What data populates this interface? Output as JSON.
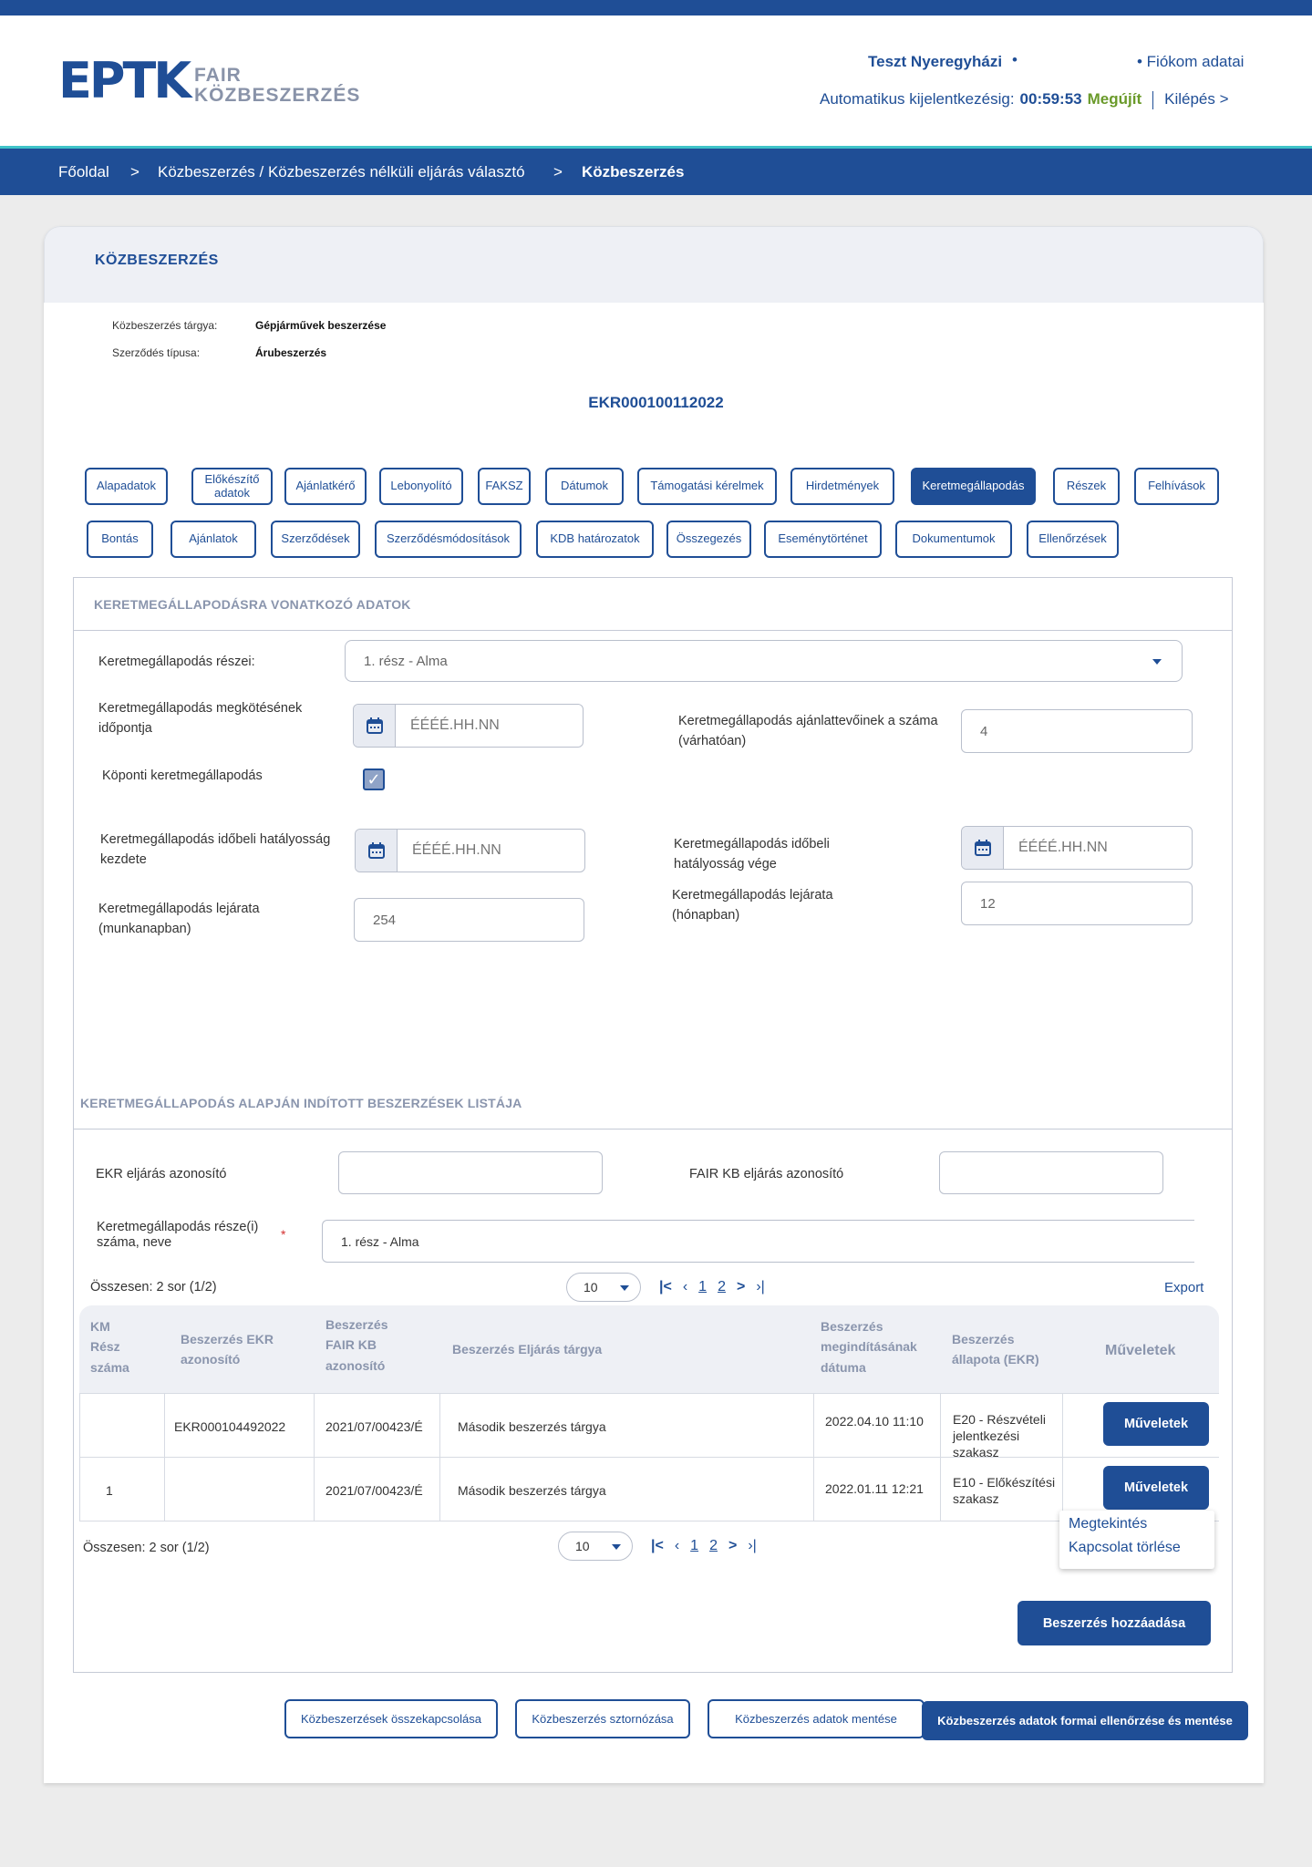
{
  "header": {
    "logo_mark": "EPTK",
    "logo_line1": "FAIR",
    "logo_line2": "KÖZBESZERZÉS",
    "user_name": "Teszt Nyeregyházi",
    "user_dot": "•",
    "account_link": "• Fiókom adatai",
    "auto_logout_label": "Automatikus kijelentkezésig:",
    "auto_logout_time": "00:59:53",
    "renew_label": "Megújít",
    "logout_label": "Kilépés >"
  },
  "breadcrumb": {
    "home": "Főoldal",
    "sep1": ">",
    "selector": "Közbeszerzés / Közbeszerzés nélküli eljárás választó",
    "sep2": ">",
    "current": "Közbeszerzés"
  },
  "card": {
    "title": "KÖZBESZERZÉS",
    "subject_label": "Közbeszerzés tárgya:",
    "subject_value": "Gépjárművek beszerzése",
    "contract_type_label": "Szerződés típusa:",
    "contract_type_value": "Árubeszerzés",
    "ekr_id": "EKR000100112022"
  },
  "tabs_row1": [
    "Alapadatok",
    "Előkészítő adatok",
    "Ajánlatkérő",
    "Lebonyolító",
    "FAKSZ",
    "Dátumok",
    "Támogatási kérelmek",
    "Hirdetmények",
    "Keretmegállapodás",
    "Részek",
    "Felhívások"
  ],
  "tabs_row2": [
    "Bontás",
    "Ajánlatok",
    "Szerződések",
    "Szerződésmódosítások",
    "KDB határozatok",
    "Összegezés",
    "Eseménytörténet",
    "Dokumentumok",
    "Ellenőrzések"
  ],
  "active_tab": "Keretmegállapodás",
  "framework": {
    "section_title": "KERETMEGÁLLAPODÁSRA VONATKOZÓ ADATOK",
    "parts_label": "Keretmegállapodás részei:",
    "parts_value": "1. rész - Alma",
    "conclusion_label": "Keretmegállapodás  megkötésének időpontja",
    "date_placeholder": "ÉÉÉÉ.HH.NN",
    "bidders_label": "Keretmegállapodás ajánlattevőinek a száma (várhatóan)",
    "bidders_value": "4",
    "central_label": "Köponti keretmegállapodás",
    "central_checked": true,
    "validity_start_label": "Keretmegállapodás időbeli hatályosság kezdete",
    "validity_end_label": "Keretmegállapodás időbeli hatályosság vége",
    "expiry_days_label": "Keretmegállapodás lejárata (munkanapban)",
    "expiry_days_value": "254",
    "expiry_months_label": "Keretmegállapodás lejárata (hónapban)",
    "expiry_months_value": "12"
  },
  "procurements": {
    "section_title": "KERETMEGÁLLAPODÁS ALAPJÁN INDÍTOTT BESZERZÉSEK LISTÁJA",
    "ekr_filter_label": "EKR eljárás azonosító",
    "ekr_filter_value": "",
    "fair_filter_label": "FAIR KB  eljárás azonosító",
    "fair_filter_value": "",
    "parts_filter_label": "Keretmegállapodás része(i) száma, neve",
    "required_mark": "*",
    "parts_filter_value": "1. rész - Alma",
    "total_text": "Összesen: 2 sor (1/2)",
    "page_size": "10",
    "pages": [
      "1",
      "2"
    ],
    "export_label": "Export",
    "columns": [
      "KM Rész száma",
      "Beszerzés EKR azonosító",
      "Beszerzés FAIR KB azonosító",
      "Beszerzés Eljárás tárgya",
      "Beszerzés megindításának dátuma",
      "Beszerzés állapota (EKR)",
      "Műveletek"
    ],
    "rows": [
      {
        "km": "",
        "ekr": "EKR000104492022",
        "fair": "2021/07/00423/É",
        "subject": "Második beszerzés tárgya",
        "date": "2022.04.10 11:10",
        "status": "E20 - Részvételi jelentkezési szakasz",
        "action": "Műveletek"
      },
      {
        "km": "1",
        "ekr": "",
        "fair": "2021/07/00423/É",
        "subject": "Második beszerzés tárgya",
        "date": "2022.01.11 12:21",
        "status": "E10 - Előkészítési szakasz",
        "action": "Műveletek"
      }
    ],
    "menu_items": [
      "Megtekintés",
      "Kapcsolat törlése"
    ],
    "add_button": "Beszerzés hozzáadása"
  },
  "footer_buttons": [
    "Közbeszerzések összekapcsolása",
    "Közbeszerzés sztornózása",
    "Közbeszerzés adatok mentése",
    "Közbeszerzés adatok formai ellenőrzése és mentése"
  ],
  "colors": {
    "primary": "#1f4e96",
    "accent": "#3fc3c8",
    "renew": "#6a9a2a"
  },
  "icons": [
    "calendar-icon",
    "check-icon",
    "chevron-down-icon",
    "first-page-icon",
    "prev-page-icon",
    "next-page-icon",
    "last-page-icon"
  ]
}
